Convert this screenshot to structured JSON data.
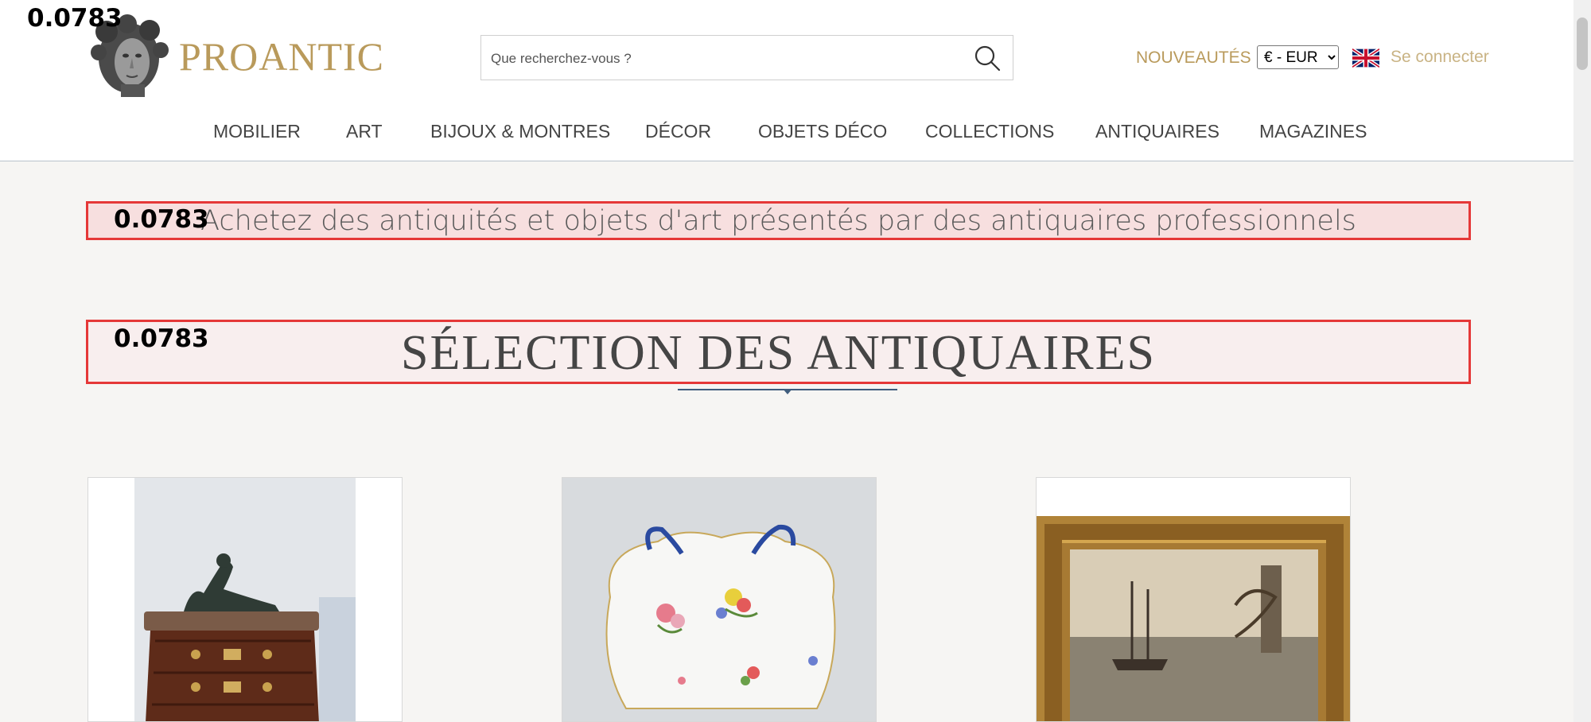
{
  "overlay": {
    "score": "0.0783"
  },
  "brand": {
    "name": "PROANTIC"
  },
  "search": {
    "placeholder": "Que recherchez-vous ?"
  },
  "header": {
    "new_label": "NOUVEAUTÉS",
    "currency_selected": "€ - EUR",
    "login_label": "Se connecter"
  },
  "nav": {
    "items": [
      "MOBILIER",
      "ART",
      "BIJOUX & MONTRES",
      "DÉCOR",
      "OBJETS DÉCO",
      "COLLECTIONS",
      "ANTIQUAIRES",
      "MAGAZINES"
    ]
  },
  "banner": {
    "tagline": "Achetez des antiquités et objets d'art présentés par des antiquaires professionnels"
  },
  "section": {
    "title": "SÉLECTION DES ANTIQUAIRES"
  },
  "colors": {
    "brand_gold": "#b99a5b",
    "highlight_border": "#e53838",
    "accent_blue": "#3f5d7d"
  },
  "icons": {
    "search": "search-icon",
    "flag": "uk-flag-icon"
  }
}
